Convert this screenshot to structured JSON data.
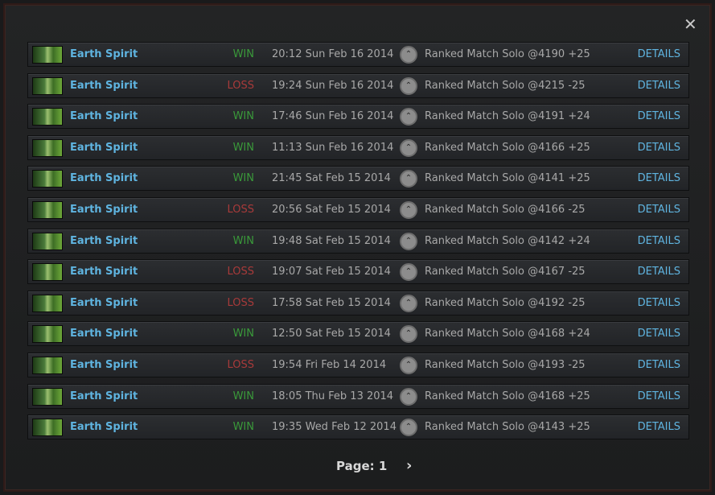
{
  "close_icon": "close-icon",
  "details_label": "DETAILS",
  "matches": [
    {
      "hero": "Earth Spirit",
      "result": "WIN",
      "date": "20:12 Sun Feb 16 2014",
      "mode": "Ranked Match Solo @4190 +25"
    },
    {
      "hero": "Earth Spirit",
      "result": "LOSS",
      "date": "19:24 Sun Feb 16 2014",
      "mode": "Ranked Match Solo @4215 -25"
    },
    {
      "hero": "Earth Spirit",
      "result": "WIN",
      "date": "17:46 Sun Feb 16 2014",
      "mode": "Ranked Match Solo @4191 +24"
    },
    {
      "hero": "Earth Spirit",
      "result": "WIN",
      "date": "11:13 Sun Feb 16 2014",
      "mode": "Ranked Match Solo @4166 +25"
    },
    {
      "hero": "Earth Spirit",
      "result": "WIN",
      "date": "21:45 Sat Feb 15 2014",
      "mode": "Ranked Match Solo @4141 +25"
    },
    {
      "hero": "Earth Spirit",
      "result": "LOSS",
      "date": "20:56 Sat Feb 15 2014",
      "mode": "Ranked Match Solo @4166 -25"
    },
    {
      "hero": "Earth Spirit",
      "result": "WIN",
      "date": "19:48 Sat Feb 15 2014",
      "mode": "Ranked Match Solo @4142 +24"
    },
    {
      "hero": "Earth Spirit",
      "result": "LOSS",
      "date": "19:07 Sat Feb 15 2014",
      "mode": "Ranked Match Solo @4167 -25"
    },
    {
      "hero": "Earth Spirit",
      "result": "LOSS",
      "date": "17:58 Sat Feb 15 2014",
      "mode": "Ranked Match Solo @4192 -25"
    },
    {
      "hero": "Earth Spirit",
      "result": "WIN",
      "date": "12:50 Sat Feb 15 2014",
      "mode": "Ranked Match Solo @4168 +24"
    },
    {
      "hero": "Earth Spirit",
      "result": "LOSS",
      "date": "19:54 Fri Feb 14 2014",
      "mode": "Ranked Match Solo @4193 -25"
    },
    {
      "hero": "Earth Spirit",
      "result": "WIN",
      "date": "18:05 Thu Feb 13 2014",
      "mode": "Ranked Match Solo @4168 +25"
    },
    {
      "hero": "Earth Spirit",
      "result": "WIN",
      "date": "19:35 Wed Feb 12 2014",
      "mode": "Ranked Match Solo @4143 +25"
    }
  ],
  "pager": {
    "label": "Page: 1",
    "next_icon": "chevron-right-icon"
  },
  "colors": {
    "win": "#3a9a3a",
    "loss": "#a83a3a",
    "accent": "#5fb4e0"
  }
}
